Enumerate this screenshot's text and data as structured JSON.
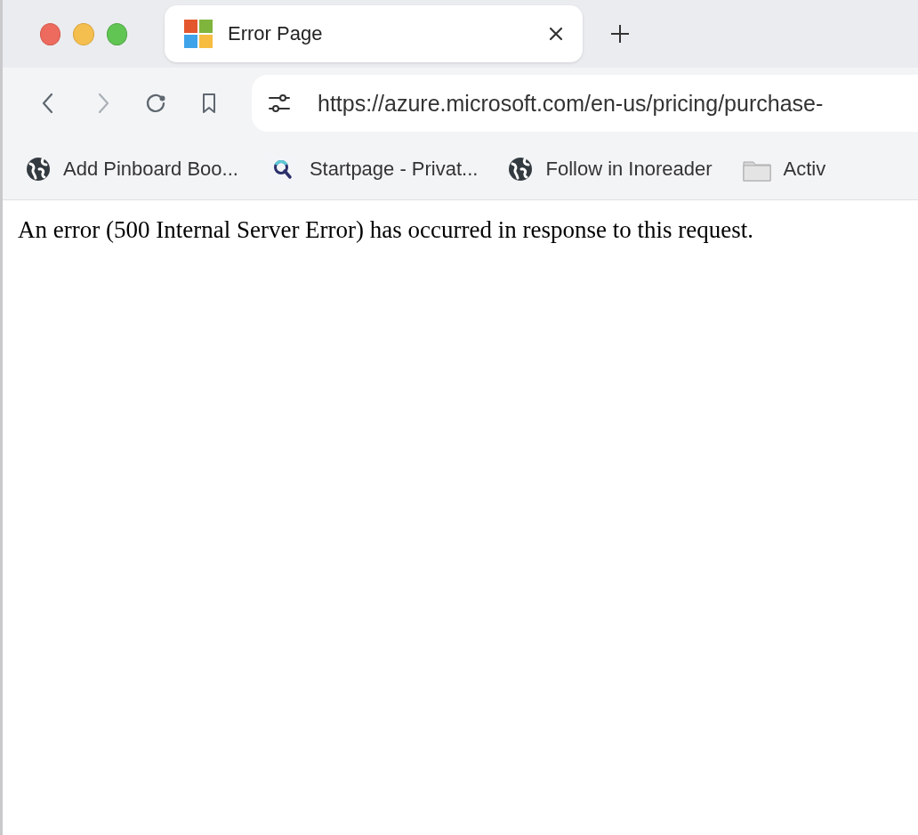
{
  "tabs": [
    {
      "title": "Error Page",
      "selected": true
    }
  ],
  "toolbar": {
    "buttons": [
      {
        "kind": "back",
        "disabled": false
      },
      {
        "kind": "forward",
        "disabled": true
      },
      {
        "kind": "reload",
        "disabled": false
      },
      {
        "kind": "bookmark",
        "disabled": false
      }
    ],
    "address": "https://azure.microsoft.com/en-us/pricing/purchase-"
  },
  "bookmarks": [
    {
      "kind": "globe",
      "label": "Add Pinboard Boo..."
    },
    {
      "kind": "startpage",
      "label": "Startpage - Privat..."
    },
    {
      "kind": "globe",
      "label": "Follow in Inoreader"
    },
    {
      "kind": "folder",
      "label": "Activ"
    }
  ],
  "page": {
    "message": "An error (500 Internal Server Error) has occurred in response to this request."
  }
}
